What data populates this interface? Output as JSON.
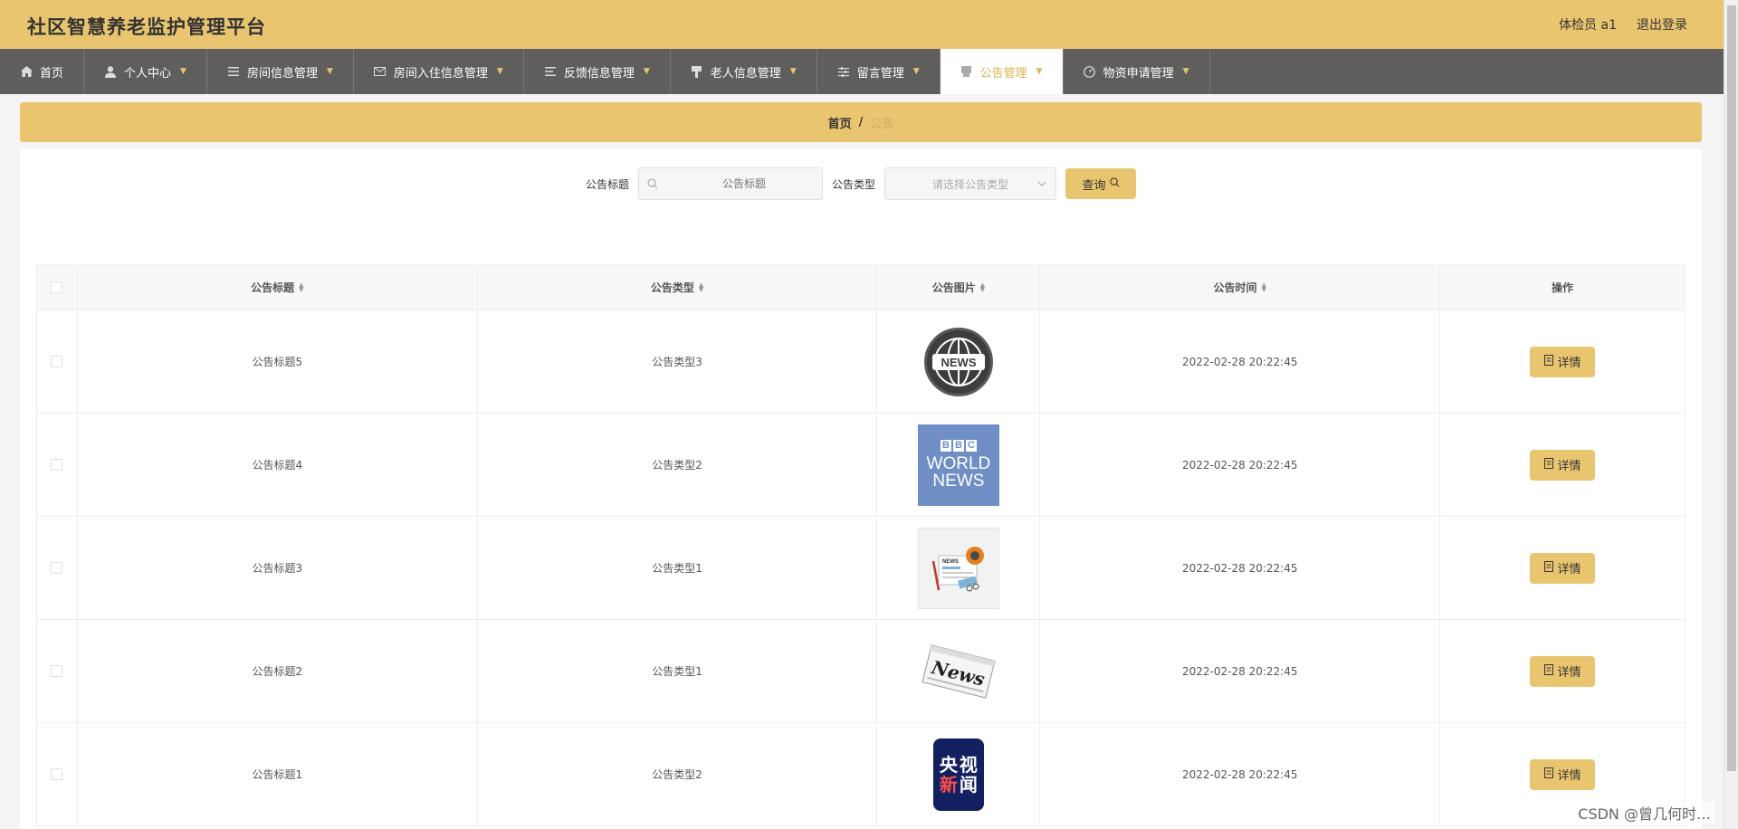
{
  "header": {
    "title": "社区智慧养老监护管理平台",
    "user": "体检员 a1",
    "logout": "退出登录"
  },
  "nav": {
    "items": [
      {
        "label": "首页",
        "icon": "home-icon",
        "has_caret": false,
        "active": false
      },
      {
        "label": "个人中心",
        "icon": "user-icon",
        "has_caret": true,
        "active": false
      },
      {
        "label": "房间信息管理",
        "icon": "list-icon",
        "has_caret": true,
        "active": false
      },
      {
        "label": "房间入住信息管理",
        "icon": "mail-icon",
        "has_caret": true,
        "active": false
      },
      {
        "label": "反馈信息管理",
        "icon": "list-icon",
        "has_caret": true,
        "active": false
      },
      {
        "label": "老人信息管理",
        "icon": "brush-icon",
        "has_caret": true,
        "active": false
      },
      {
        "label": "留言管理",
        "icon": "sliders-icon",
        "has_caret": true,
        "active": false
      },
      {
        "label": "公告管理",
        "icon": "notice-icon",
        "has_caret": true,
        "active": true
      },
      {
        "label": "物资申请管理",
        "icon": "gauge-icon",
        "has_caret": true,
        "active": false
      }
    ]
  },
  "breadcrumb": {
    "home": "首页",
    "separator": "/",
    "current": "公告"
  },
  "search": {
    "title_label": "公告标题",
    "title_placeholder": "公告标题",
    "type_label": "公告类型",
    "type_placeholder": "请选择公告类型",
    "query_button": "查询"
  },
  "table": {
    "columns": {
      "title": "公告标题",
      "type": "公告类型",
      "image": "公告图片",
      "time": "公告时间",
      "operation": "操作"
    },
    "detail_label": "详情",
    "rows": [
      {
        "title": "公告标题5",
        "type": "公告类型3",
        "image": "news-globe",
        "time": "2022-02-28 20:22:45"
      },
      {
        "title": "公告标题4",
        "type": "公告类型2",
        "image": "bbc-world-news",
        "time": "2022-02-28 20:22:45"
      },
      {
        "title": "公告标题3",
        "type": "公告类型1",
        "image": "newspaper-illustration",
        "time": "2022-02-28 20:22:45"
      },
      {
        "title": "公告标题2",
        "type": "公告类型1",
        "image": "news-paper",
        "time": "2022-02-28 20:22:45"
      },
      {
        "title": "公告标题1",
        "type": "公告类型2",
        "image": "cctv-news",
        "time": "2022-02-28 20:22:45"
      }
    ]
  },
  "images": {
    "globe_text": "NEWS",
    "bbc_blocks": [
      "B",
      "B",
      "C"
    ],
    "bbc_line1": "WORLD",
    "bbc_line2": "NEWS",
    "paper_label": "NEWS",
    "paper_big": "News",
    "cctv_chars": [
      "央",
      "视",
      "新",
      "闻"
    ]
  },
  "watermark": "CSDN @曾几何时…",
  "colors": {
    "accent": "#e9c56f",
    "nav_bg": "#5f5e5c",
    "active_text": "#e0b350"
  }
}
